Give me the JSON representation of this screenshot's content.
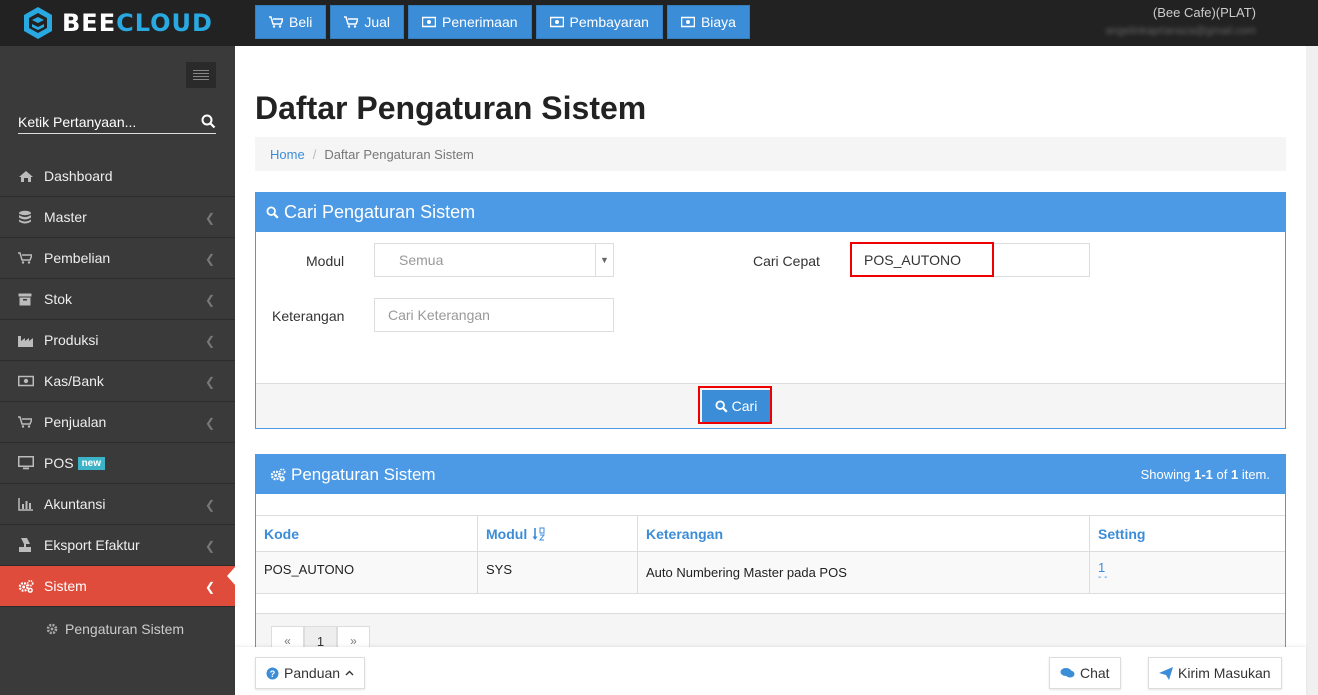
{
  "brand": {
    "name_part1": "BEE",
    "name_part2": "CLOUD",
    "accent": "#29a9e1"
  },
  "topnav": [
    {
      "label": "Beli",
      "icon": "cart-icon"
    },
    {
      "label": "Jual",
      "icon": "cart-icon"
    },
    {
      "label": "Penerimaan",
      "icon": "money-icon"
    },
    {
      "label": "Pembayaran",
      "icon": "money-icon"
    },
    {
      "label": "Biaya",
      "icon": "money-icon"
    }
  ],
  "user": {
    "company": "(Bee Cafe)(PLAT)",
    "email": "angelinkaprianaza@gmail.com"
  },
  "sidebar": {
    "search_placeholder": "Ketik Pertanyaan...",
    "items": [
      {
        "label": "Dashboard",
        "icon": "home-icon"
      },
      {
        "label": "Master",
        "icon": "database-icon"
      },
      {
        "label": "Pembelian",
        "icon": "cart-icon"
      },
      {
        "label": "Stok",
        "icon": "box-icon"
      },
      {
        "label": "Produksi",
        "icon": "factory-icon"
      },
      {
        "label": "Kas/Bank",
        "icon": "money-icon"
      },
      {
        "label": "Penjualan",
        "icon": "cart-icon"
      },
      {
        "label": "POS",
        "icon": "monitor-icon",
        "badge": "new"
      },
      {
        "label": "Akuntansi",
        "icon": "chart-icon"
      },
      {
        "label": "Eksport Efaktur",
        "icon": "export-icon"
      },
      {
        "label": "Sistem",
        "icon": "gears-icon",
        "active": true
      }
    ],
    "subitem": {
      "label": "Pengaturan Sistem",
      "icon": "gear-icon"
    },
    "active_color": "#e04c3c"
  },
  "page": {
    "title": "Daftar Pengaturan Sistem",
    "breadcrumb": {
      "home": "Home",
      "separator": "/",
      "current": "Daftar Pengaturan Sistem"
    }
  },
  "search_panel": {
    "title": "Cari Pengaturan Sistem",
    "modul_label": "Modul",
    "modul_value": "Semua",
    "cari_cepat_label": "Cari Cepat",
    "cari_cepat_value": "POS_AUTONO",
    "keterangan_label": "Keterangan",
    "keterangan_placeholder": "Cari Keterangan",
    "submit_label": "Cari"
  },
  "results_panel": {
    "title": "Pengaturan Sistem",
    "showing_prefix": "Showing ",
    "showing_range": "1-1",
    "showing_of": " of ",
    "showing_total": "1",
    "showing_suffix": " item.",
    "columns": [
      "Kode",
      "Modul",
      "Keterangan",
      "Setting"
    ],
    "rows": [
      {
        "kode": "POS_AUTONO",
        "modul": "SYS",
        "keterangan": "Auto Numbering Master pada POS",
        "setting": "1",
        "setting_sub": "- -"
      }
    ],
    "pager": {
      "prev": "«",
      "current": "1",
      "next": "»"
    }
  },
  "footer": {
    "guide": "Panduan",
    "chat": "Chat",
    "feedback": "Kirim Masukan"
  }
}
